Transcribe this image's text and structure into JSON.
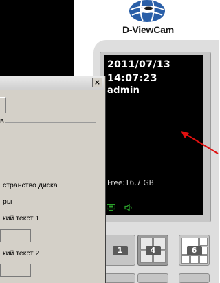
{
  "logo": {
    "text": "D-ViewCam",
    "globe_color": "#2a5fa8"
  },
  "status": {
    "date": "2011/07/13",
    "time": "14:07:23",
    "user": "admin",
    "free_space": "Free:16,7 GB",
    "icons": [
      "monitor-icon",
      "speaker-icon"
    ]
  },
  "layout_buttons": [
    {
      "label": "1",
      "pressed": false
    },
    {
      "label": "4",
      "pressed": true
    },
    {
      "label": "6",
      "pressed": false
    }
  ],
  "dialog": {
    "close_label": "×",
    "group_label": "в",
    "disk_space_label": "странство диска",
    "params_label": "ры",
    "text1_label": "кий текст 1",
    "text2_label": "кий текст 2"
  },
  "annotation": {
    "arrow_color": "#e01010"
  }
}
